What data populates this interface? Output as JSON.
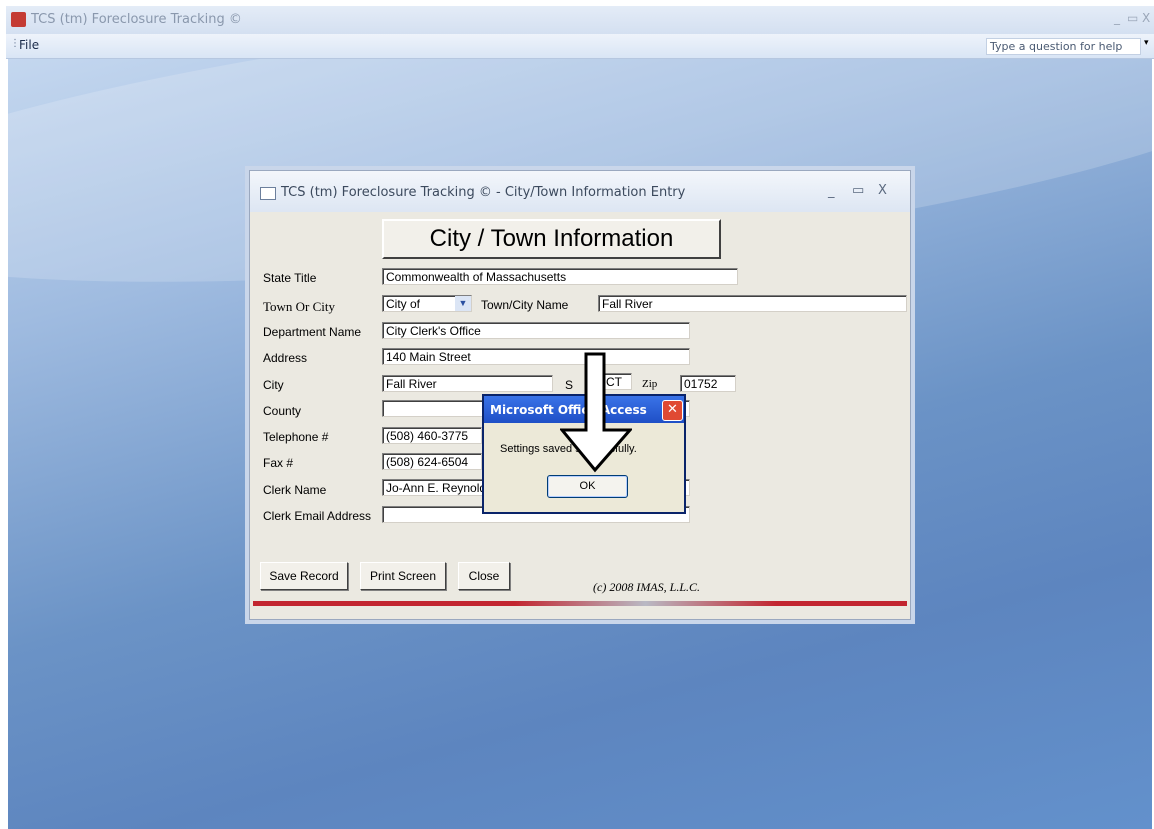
{
  "app": {
    "title": "TCS (tm) Foreclosure Tracking ©",
    "min": "_",
    "max": "▭",
    "close": "X"
  },
  "menu": {
    "file": "File",
    "help_placeholder": "Type a question for help",
    "help_drop": "▾"
  },
  "form": {
    "title": "TCS (tm) Foreclosure Tracking © - City/Town Information Entry",
    "heading": "City / Town Information",
    "labels": {
      "state_title": "State Title",
      "town_or_city": "Town Or City",
      "town_city_name": "Town/City Name",
      "department_name": "Department Name",
      "address": "Address",
      "city": "City",
      "state": "S",
      "zip": "Zip",
      "county": "County",
      "telephone": "Telephone #",
      "fax": "Fax #",
      "clerk_name": "Clerk Name",
      "clerk_email": "Clerk Email Address"
    },
    "values": {
      "state_title": "Commonwealth of Massachusetts",
      "town_or_city": "City of",
      "town_city_name": "Fall River",
      "department_name": "City Clerk's Office",
      "address": "140 Main Street",
      "city": "Fall River",
      "state": "CT",
      "zip": "01752",
      "county": "",
      "telephone": "(508) 460-3775",
      "fax": "(508) 624-6504",
      "clerk_name": "Jo-Ann E. Reynolds",
      "clerk_email": ""
    },
    "buttons": {
      "save": "Save Record",
      "print": "Print Screen",
      "close": "Close"
    },
    "copyright": "(c) 2008 IMAS, L.L.C."
  },
  "dialog": {
    "title": "Microsoft Office Access",
    "message": "Settings saved successfully.",
    "ok": "OK"
  },
  "colors": {
    "workspace": "#6b93c6",
    "form_bg": "#ebe9e1",
    "dialog_title": "#1f4fc6",
    "footer_strip": "#c22630"
  }
}
